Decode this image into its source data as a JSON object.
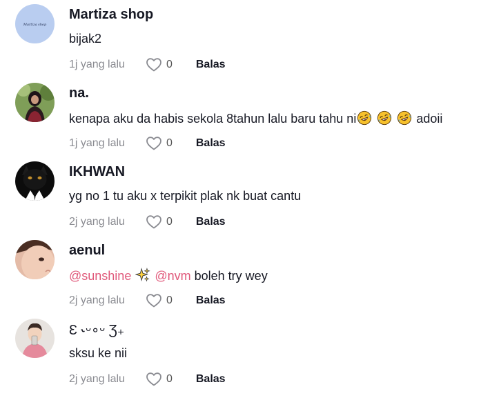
{
  "comments": [
    {
      "username": "Martiza shop",
      "avatar_text": "Martiza shop",
      "text": "bijak2",
      "time": "1j yang lalu",
      "likes": "0",
      "reply_label": "Balas"
    },
    {
      "username": "na.",
      "text_before": "kenapa aku da habis sekola 8tahun lalu baru tahu ni",
      "text_after": "adoii",
      "emoji": "rolling-on-floor-laughing-emoji",
      "emoji_count": 3,
      "time": "1j yang lalu",
      "likes": "0",
      "reply_label": "Balas"
    },
    {
      "username": "IKHWAN",
      "text": "yg no 1 tu aku x terpikit plak nk buat cantu",
      "time": "2j yang lalu",
      "likes": "0",
      "reply_label": "Balas"
    },
    {
      "username": "aenul",
      "mention1": "@sunshine",
      "emoji": "sparkles-emoji",
      "mention2": "@nvm",
      "text_after": " boleh try wey",
      "time": "2j yang lalu",
      "likes": "0",
      "reply_label": "Balas"
    },
    {
      "username": "Ɛ ˞ᵕ∘ᵕ Ʒ₊",
      "text": "sksu ke nii",
      "time": "2j yang lalu",
      "likes": "0",
      "reply_label": "Balas"
    }
  ],
  "colors": {
    "text": "#161823",
    "meta": "#8a8b91",
    "mention": "#e0587a",
    "heart_outline": "#8a8b91",
    "avatar_shop_bg": "#b9cdf0"
  },
  "icons": {
    "like": "heart-outline-icon"
  }
}
